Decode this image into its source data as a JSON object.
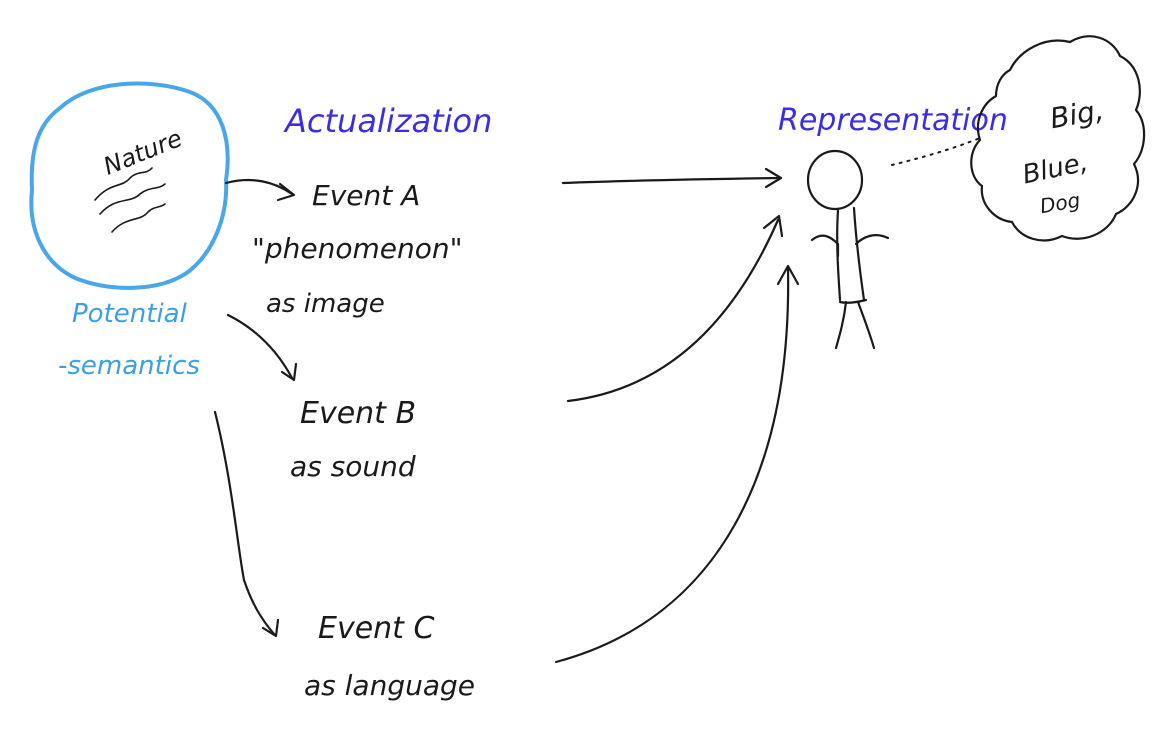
{
  "nature": {
    "label": "Nature",
    "caption_line1": "Potential",
    "caption_line2": "-semantics"
  },
  "actualization": {
    "heading": "Actualization"
  },
  "events": [
    {
      "title": "Event A",
      "line2": "\"phenomenon\"",
      "line3": "as image"
    },
    {
      "title": "Event B",
      "line2": "as sound"
    },
    {
      "title": "Event C",
      "line2": "as language"
    }
  ],
  "representation": {
    "heading": "Representation"
  },
  "thought": {
    "line1": "Big,",
    "line2": "Blue,",
    "line3": "Dog"
  },
  "colors": {
    "ink": "#1a1a1a",
    "heading_blue": "#3a2ee0",
    "nature_cyan": "#49a6e8"
  }
}
